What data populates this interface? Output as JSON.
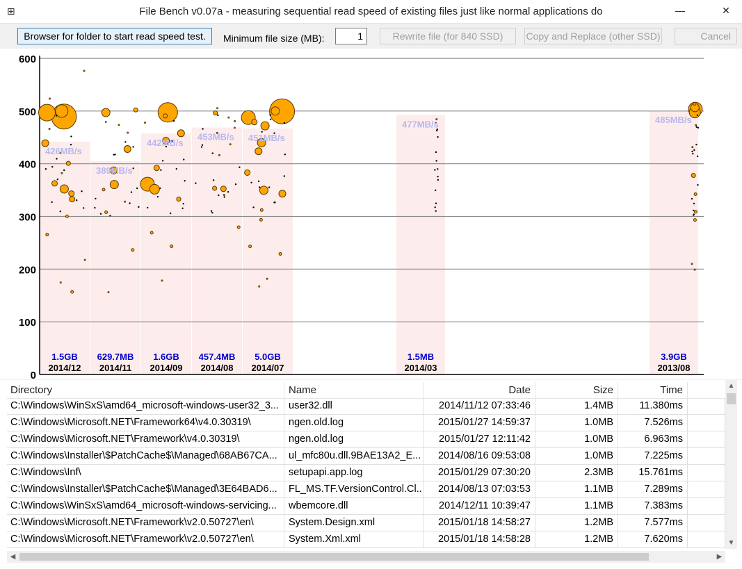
{
  "window": {
    "title": "File Bench v0.07a - measuring sequential read speed of existing files just like normal applications do",
    "app_icon": "⊞",
    "minimize_glyph": "—",
    "close_glyph": "✕"
  },
  "toolbar": {
    "browse_label": "Browser for folder to start read speed test.",
    "min_size_label": "Minimum file size (MB):",
    "min_size_value": "1",
    "rewrite_label": "Rewrite file (for 840 SSD)",
    "copy_label": "Copy and Replace (other SSD)",
    "cancel_label": "Cancel"
  },
  "chart_data": {
    "type": "scatter",
    "title": "",
    "xlabel": "",
    "ylabel": "",
    "ylim": [
      0,
      600
    ],
    "yticks": [
      0,
      100,
      200,
      300,
      400,
      500,
      600
    ],
    "grid": true,
    "colors": {
      "point": "#ffa500",
      "point_edge": "#5a3a00",
      "band": "#fdecec",
      "size_label": "#0000cc",
      "avg_label": "#b8b8f0",
      "gridline": "#8a8a8a"
    },
    "groups": [
      {
        "month": "2014/12",
        "size": "1.5GB",
        "avg": "426MB/s",
        "avg_value": 426
      },
      {
        "month": "2014/11",
        "size": "629.7MB",
        "avg": "389MB/s",
        "avg_value": 389
      },
      {
        "month": "2014/09",
        "size": "1.6GB",
        "avg": "442MB/s",
        "avg_value": 442
      },
      {
        "month": "2014/08",
        "size": "457.4MB",
        "avg": "453MB/s",
        "avg_value": 453
      },
      {
        "month": "2014/07",
        "size": "5.0GB",
        "avg": "451MB/s",
        "avg_value": 451
      },
      {
        "month": "2014/03",
        "size": "1.5MB",
        "avg": "477MB/s",
        "avg_value": 477
      },
      {
        "month": "2013/08",
        "size": "3.9GB",
        "avg": "485MB/s",
        "avg_value": 485
      }
    ]
  },
  "grid": {
    "columns": [
      "Directory",
      "Name",
      "Date",
      "Size",
      "Time"
    ],
    "rows": [
      {
        "directory": "C:\\Windows\\WinSxS\\amd64_microsoft-windows-user32_3...",
        "name": "user32.dll",
        "date": "2014/11/12 07:33:46",
        "size": "1.4MB",
        "time": "11.380ms"
      },
      {
        "directory": "C:\\Windows\\Microsoft.NET\\Framework64\\v4.0.30319\\",
        "name": "ngen.old.log",
        "date": "2015/01/27 14:59:37",
        "size": "1.0MB",
        "time": "7.526ms"
      },
      {
        "directory": "C:\\Windows\\Microsoft.NET\\Framework\\v4.0.30319\\",
        "name": "ngen.old.log",
        "date": "2015/01/27 12:11:42",
        "size": "1.0MB",
        "time": "6.963ms"
      },
      {
        "directory": "C:\\Windows\\Installer\\$PatchCache$\\Managed\\68AB67CA...",
        "name": "ul_mfc80u.dll.9BAE13A2_E...",
        "date": "2014/08/16 09:53:08",
        "size": "1.0MB",
        "time": "7.225ms"
      },
      {
        "directory": "C:\\Windows\\Inf\\",
        "name": "setupapi.app.log",
        "date": "2015/01/29 07:30:20",
        "size": "2.3MB",
        "time": "15.761ms"
      },
      {
        "directory": "C:\\Windows\\Installer\\$PatchCache$\\Managed\\3E64BAD6...",
        "name": "FL_MS.TF.VersionControl.Cl...",
        "date": "2014/08/13 07:03:53",
        "size": "1.1MB",
        "time": "7.289ms"
      },
      {
        "directory": "C:\\Windows\\WinSxS\\amd64_microsoft-windows-servicing...",
        "name": "wbemcore.dll",
        "date": "2014/12/11 10:39:47",
        "size": "1.1MB",
        "time": "7.383ms"
      },
      {
        "directory": "C:\\Windows\\Microsoft.NET\\Framework\\v2.0.50727\\en\\",
        "name": "System.Design.xml",
        "date": "2015/01/18 14:58:27",
        "size": "1.2MB",
        "time": "7.577ms"
      },
      {
        "directory": "C:\\Windows\\Microsoft.NET\\Framework\\v2.0.50727\\en\\",
        "name": "System.Xml.xml",
        "date": "2015/01/18 14:58:28",
        "size": "1.2MB",
        "time": "7.620ms"
      }
    ]
  }
}
